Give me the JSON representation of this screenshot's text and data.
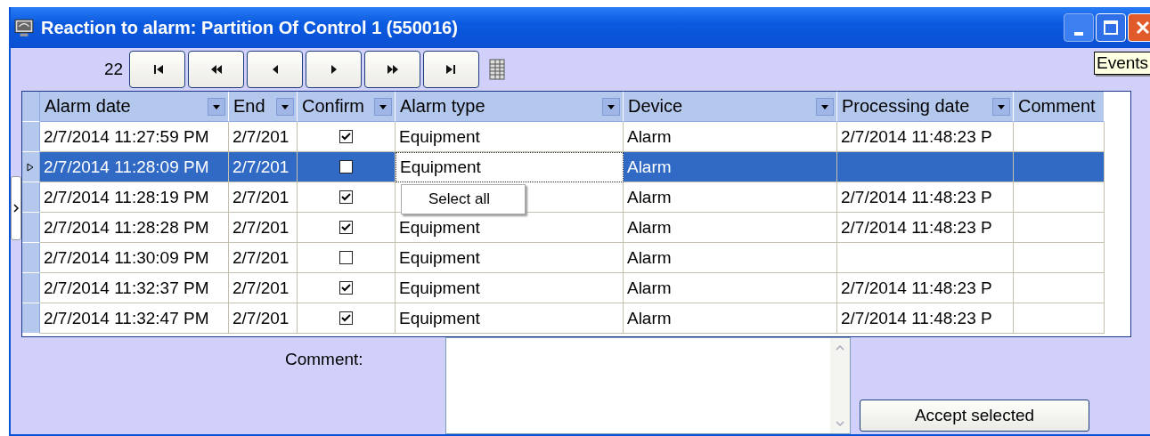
{
  "window": {
    "title": "Reaction to alarm: Partition Of Control 1 (550016)"
  },
  "navigator": {
    "count": "22",
    "buttons": [
      {
        "kind": "first"
      },
      {
        "kind": "rewind"
      },
      {
        "kind": "prev"
      },
      {
        "kind": "next"
      },
      {
        "kind": "forward"
      },
      {
        "kind": "last"
      }
    ]
  },
  "tooltip": {
    "text": "Events"
  },
  "table": {
    "columns": [
      {
        "label": "Alarm date",
        "filter": true
      },
      {
        "label": "End",
        "filter": true
      },
      {
        "label": "Confirm",
        "filter": true
      },
      {
        "label": "Alarm type",
        "filter": true
      },
      {
        "label": "Device",
        "filter": true
      },
      {
        "label": "Processing date",
        "filter": true
      },
      {
        "label": "Comment",
        "filter": false
      }
    ],
    "rows": [
      {
        "selected": false,
        "alarm_type_focused": false,
        "alarm_date": "2/7/2014 11:27:59 PM",
        "end": "2/7/201",
        "confirmed": true,
        "alarm_type": "Equipment",
        "device": "Alarm",
        "processing_date": "2/7/2014 11:48:23 P"
      },
      {
        "selected": true,
        "alarm_type_focused": true,
        "alarm_date": "2/7/2014 11:28:09 PM",
        "end": "2/7/201",
        "confirmed": false,
        "alarm_type": "Equipment",
        "device": "Alarm"
      },
      {
        "selected": false,
        "alarm_type_focused": false,
        "alarm_date": "2/7/2014 11:28:19 PM",
        "end": "2/7/201",
        "confirmed": true,
        "device": "Alarm",
        "processing_date": "2/7/2014 11:48:23 P"
      },
      {
        "selected": false,
        "alarm_type_focused": false,
        "alarm_date": "2/7/2014 11:28:28 PM",
        "end": "2/7/201",
        "confirmed": true,
        "alarm_type": "Equipment",
        "device": "Alarm",
        "processing_date": "2/7/2014 11:48:23 P"
      },
      {
        "selected": false,
        "alarm_type_focused": false,
        "alarm_date": "2/7/2014 11:30:09 PM",
        "end": "2/7/201",
        "confirmed": false,
        "alarm_type": "Equipment",
        "device": "Alarm"
      },
      {
        "selected": false,
        "alarm_type_focused": false,
        "alarm_date": "2/7/2014 11:32:37 PM",
        "end": "2/7/201",
        "confirmed": true,
        "alarm_type": "Equipment",
        "device": "Alarm",
        "processing_date": "2/7/2014 11:48:23 P"
      },
      {
        "selected": false,
        "alarm_type_focused": false,
        "alarm_date": "2/7/2014 11:32:47 PM",
        "end": "2/7/201",
        "confirmed": true,
        "alarm_type": "Equipment",
        "device": "Alarm",
        "processing_date": "2/7/2014 11:48:23 P"
      }
    ]
  },
  "context_menu": {
    "items": [
      {
        "label": "Select all"
      }
    ]
  },
  "comment": {
    "label": "Comment:"
  },
  "accept_button": {
    "label": "Accept selected"
  }
}
